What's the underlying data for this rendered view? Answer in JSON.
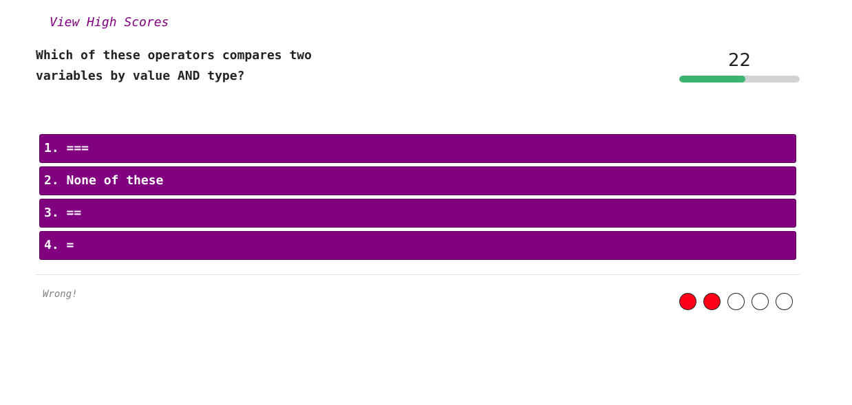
{
  "header": {
    "high_scores_label": "View High Scores"
  },
  "question": {
    "text": "Which of these operators compares two variables by value AND type?"
  },
  "timer": {
    "value": "22",
    "fraction_remaining": 0.55
  },
  "answers": [
    {
      "label": "1. ==="
    },
    {
      "label": "2. None of these"
    },
    {
      "label": "3. =="
    },
    {
      "label": "4. ="
    }
  ],
  "feedback": {
    "text": "Wrong!"
  },
  "progress_dots": [
    {
      "status": "wrong",
      "color": "#ff0019"
    },
    {
      "status": "wrong",
      "color": "#ff0019"
    },
    {
      "status": "unanswered",
      "color": "#ffffff"
    },
    {
      "status": "unanswered",
      "color": "#ffffff"
    },
    {
      "status": "unanswered",
      "color": "#ffffff"
    }
  ],
  "colors": {
    "accent": "#800080",
    "timer_fill": "#3cb371",
    "timer_track": "#d3d3d3"
  }
}
